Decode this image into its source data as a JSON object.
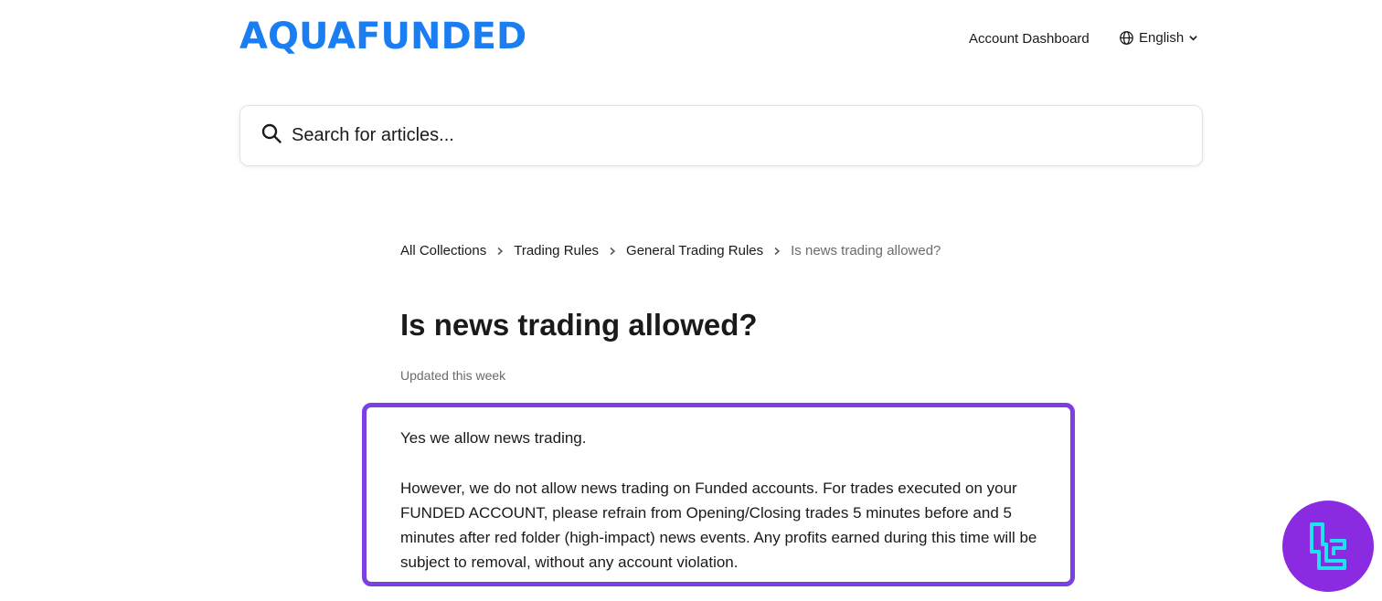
{
  "header": {
    "logo_text": "AQUAFUNDED",
    "nav_link": "Account Dashboard",
    "language": "English"
  },
  "search": {
    "placeholder": "Search for articles..."
  },
  "breadcrumb": {
    "items": [
      "All Collections",
      "Trading Rules",
      "General Trading Rules"
    ],
    "current": "Is news trading allowed?"
  },
  "article": {
    "title": "Is news trading allowed?",
    "updated": "Updated this week",
    "paragraphs": [
      "Yes we allow news trading.",
      "However, we do not allow news trading on Funded accounts. For trades executed on your FUNDED ACCOUNT, please refrain from Opening/Closing trades 5 minutes before and 5 minutes after red folder (high-impact) news events. Any profits earned during this time will be subject to removal, without any account violation."
    ]
  },
  "colors": {
    "brand_blue": "#1a7ef2",
    "highlight_purple": "#7b3fe4",
    "badge_purple": "#8a2be2",
    "badge_icon": "#22e0f0"
  },
  "icons": {
    "search": "search-icon",
    "globe": "globe-icon",
    "chevron": "chevron-down-icon",
    "breadcrumb_sep": "chevron-right-icon",
    "badge": "tradingfinder-logo-icon"
  }
}
